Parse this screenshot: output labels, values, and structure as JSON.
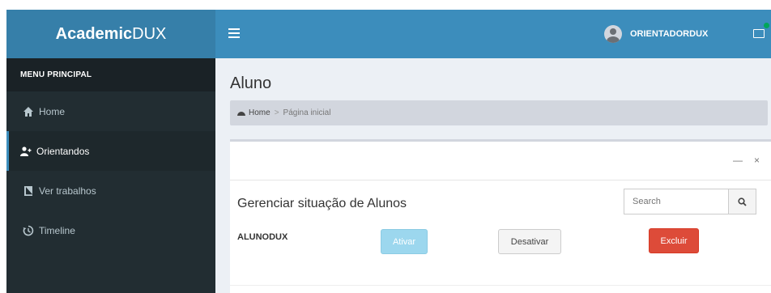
{
  "brand": {
    "bold": "Academic",
    "normal": "DUX"
  },
  "sidebar": {
    "header": "MENU PRINCIPAL",
    "items": [
      {
        "label": "Home",
        "icon": "home-icon"
      },
      {
        "label": "Orientandos",
        "icon": "users-icon",
        "active": true
      },
      {
        "label": "Ver trabalhos",
        "icon": "book-icon"
      },
      {
        "label": "Timeline",
        "icon": "history-icon"
      }
    ]
  },
  "topbar": {
    "username": "ORIENTADORDUX"
  },
  "page": {
    "title": "Aluno"
  },
  "breadcrumb": {
    "home": "Home",
    "separator": ">",
    "current": "Página inicial"
  },
  "box": {
    "tools": {
      "collapse": "—",
      "close": "×"
    },
    "title": "Gerenciar situação de Alunos",
    "search_placeholder": "Search",
    "row": {
      "name": "ALUNODUX",
      "ativar": "Ativar",
      "desativar": "Desativar",
      "excluir": "Excluir"
    }
  },
  "colors": {
    "header_blue": "#3c8dbc",
    "logo_blue": "#367fa9",
    "sidebar_dark": "#222d32",
    "danger": "#dd4b39",
    "info_disabled": "#9cd7ee"
  }
}
